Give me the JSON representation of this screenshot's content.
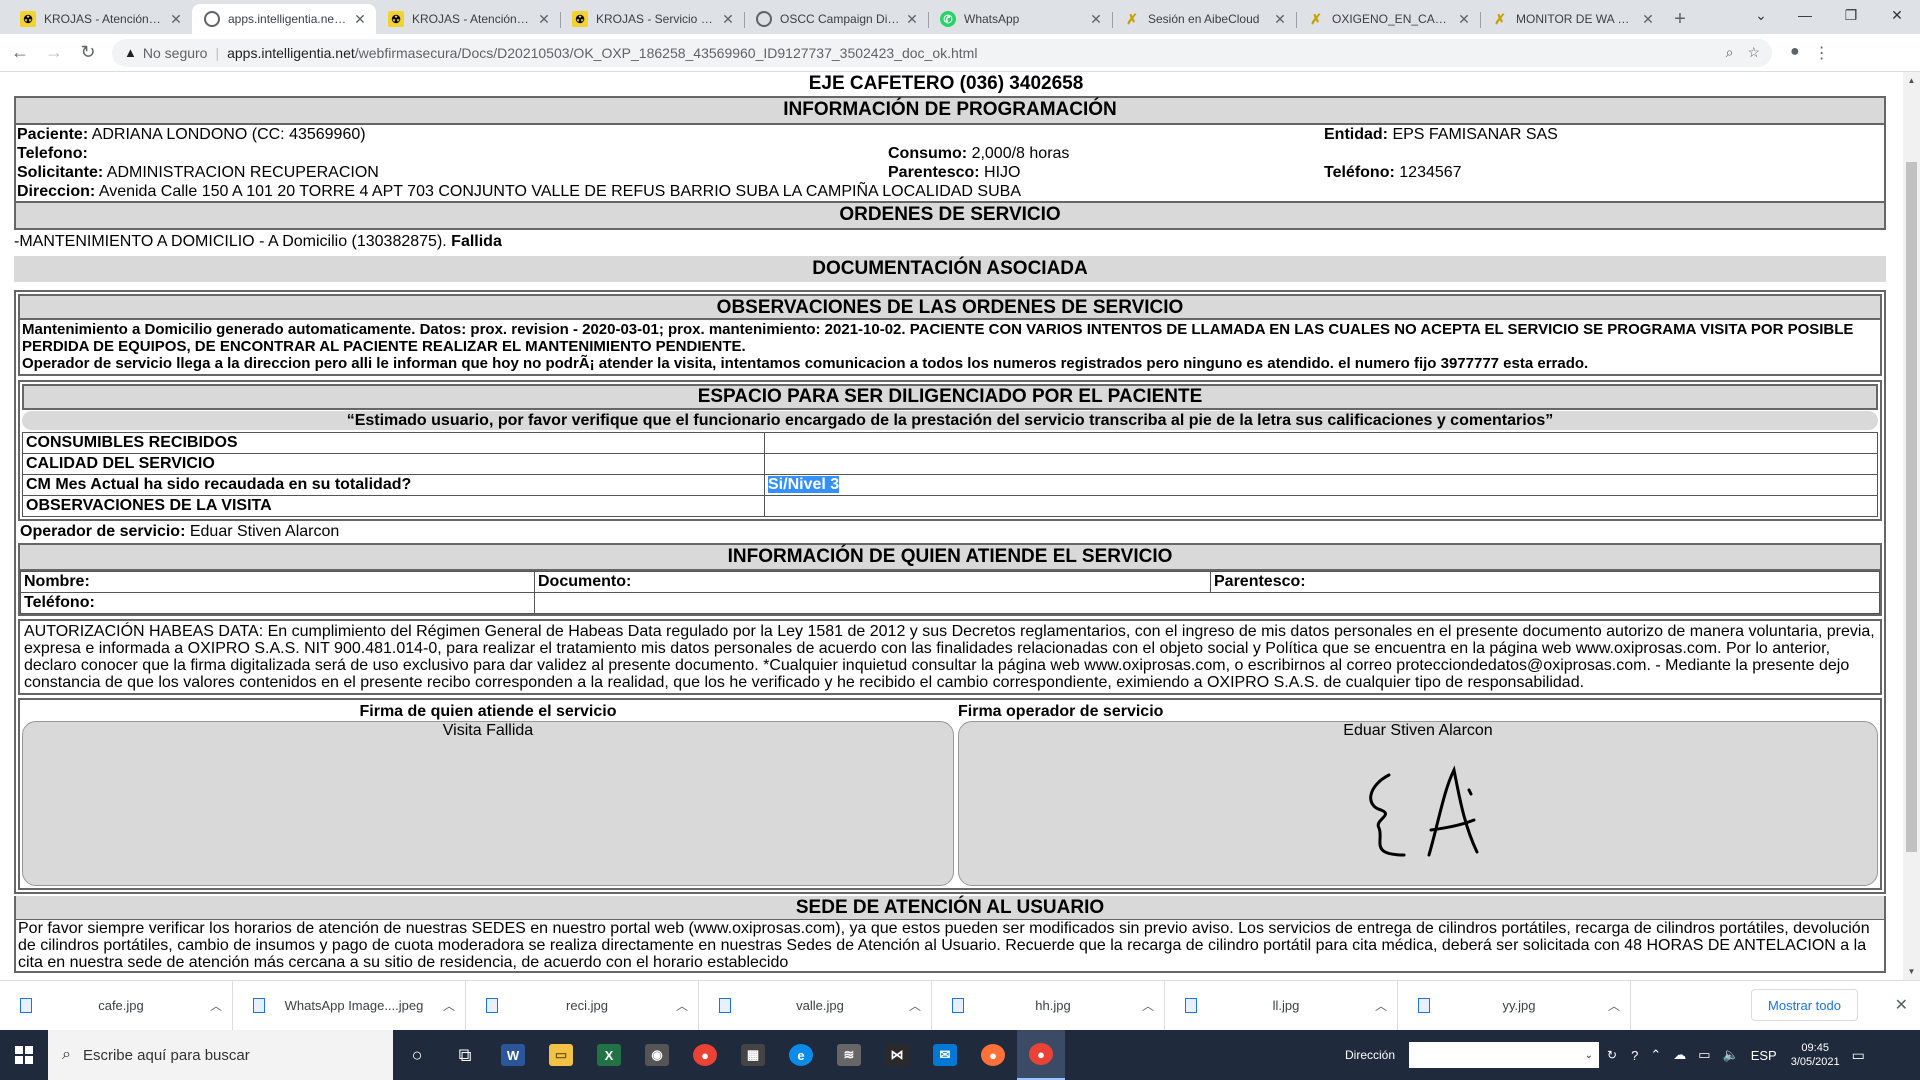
{
  "browser": {
    "tabs": [
      {
        "title": "KROJAS - Atención al Usuario",
        "icon": "krojas"
      },
      {
        "title": "apps.intelligentia.net/webfirmasecura",
        "icon": "globe",
        "active": true
      },
      {
        "title": "KROJAS - Atención al Usuario",
        "icon": "krojas"
      },
      {
        "title": "KROJAS - Servicio a Domicilio",
        "icon": "krojas"
      },
      {
        "title": "OSCC Campaign Director",
        "icon": "globe"
      },
      {
        "title": "WhatsApp",
        "icon": "whatsapp"
      },
      {
        "title": "Sesión en AibeCloud",
        "icon": "x"
      },
      {
        "title": "OXIGENO_EN_CASA (S",
        "icon": "x"
      },
      {
        "title": "MONITOR DE WA PEN",
        "icon": "x"
      }
    ],
    "new_tab_glyph": "+",
    "url_warning": "No seguro",
    "url_host": "apps.intelligentia.net",
    "url_path": "/webfirmasecura/Docs/D20210503/OK_OXP_186258_43569960_ID9127737_3502423_doc_ok.html"
  },
  "doc": {
    "top_line": "EJE CAFETERO (036) 3402658",
    "programacion": {
      "title": "INFORMACIÓN DE PROGRAMACIÓN",
      "paciente_label": "Paciente:",
      "paciente": "ADRIANA LONDONO (CC: 43569960)",
      "entidad_label": "Entidad:",
      "entidad": "EPS FAMISANAR SAS",
      "telefono_label": "Telefono:",
      "telefono": "",
      "consumo_label": "Consumo:",
      "consumo": "2,000/8 horas",
      "solicitante_label": "Solicitante:",
      "solicitante": "ADMINISTRACION RECUPERACION",
      "parentesco_label": "Parentesco:",
      "parentesco": "HIJO",
      "telefono2_label": "Teléfono:",
      "telefono2": "1234567",
      "direccion_label": "Direccion:",
      "direccion": "Avenida Calle 150 A 101 20 TORRE 4 APT 703 CONJUNTO VALLE DE REFUS BARRIO SUBA LA CAMPIÑA LOCALIDAD SUBA"
    },
    "ordenes": {
      "title": "ORDENES DE SERVICIO",
      "line": "-MANTENIMIENTO A DOMICILIO - A Domicilio (130382875).",
      "status": "Fallida"
    },
    "documentacion_title": "DOCUMENTACIÓN ASOCIADA",
    "observaciones": {
      "title": "OBSERVACIONES DE LAS ORDENES DE SERVICIO",
      "text1": "Mantenimiento a Domicilio generado automaticamente. Datos: prox. revision - 2020-03-01; prox. mantenimiento: 2021-10-02. PACIENTE CON VARIOS INTENTOS DE LLAMADA EN LAS CUALES NO ACEPTA EL SERVICIO SE PROGRAMA VISITA POR POSIBLE PERDIDA DE EQUIPOS, DE ENCONTRAR AL PACIENTE REALIZAR EL MANTENIMIENTO PENDIENTE.",
      "text2": "Operador de servicio llega a la direccion pero alli le informan que hoy no podrÃ¡ atender la visita, intentamos comunicacion a todos los numeros registrados pero ninguno es atendido. el numero fijo 3977777 esta errado."
    },
    "espacio": {
      "title": "ESPACIO PARA SER DILIGENCIADO POR EL PACIENTE",
      "notice": "“Estimado usuario, por favor verifique que el funcionario encargado de la prestación del servicio transcriba al pie de la letra sus calificaciones y comentarios”",
      "rows": [
        {
          "label": "CONSUMIBLES RECIBIDOS",
          "value": ""
        },
        {
          "label": "CALIDAD DEL SERVICIO",
          "value": ""
        },
        {
          "label": "CM Mes Actual ha sido recaudada en su totalidad?",
          "value": "Si/Nivel 3"
        },
        {
          "label": "OBSERVACIONES DE LA VISITA",
          "value": ""
        }
      ],
      "operador_label": "Operador de servicio:",
      "operador": "Eduar Stiven Alarcon"
    },
    "atiende": {
      "title": "INFORMACIÓN DE QUIEN ATIENDE EL SERVICIO",
      "nombre_label": "Nombre:",
      "documento_label": "Documento:",
      "parentesco_label": "Parentesco:",
      "telefono_label": "Teléfono:"
    },
    "habeas": "AUTORIZACIÓN HABEAS DATA: En cumplimiento del Régimen General de Habeas Data regulado por la Ley 1581 de 2012 y sus Decretos reglamentarios, con el ingreso de mis datos personales en el presente documento autorizo de manera voluntaria, previa, expresa e informada a OXIPRO S.A.S. NIT 900.481.014-0, para realizar el tratamiento mis datos personales de acuerdo con las finalidades relacionadas con el objeto social y Política que se encuentra en la página web www.oxiprosas.com. Por lo anterior, declaro conocer que la firma digitalizada será de uso exclusivo para dar validez al presente documento. *Cualquier inquietud consultar la página web www.oxiprosas.com, o escribirnos al correo protecciondedatos@oxiprosas.com. - Mediante la presente dejo constancia de que los valores contenidos en el presente recibo corresponden a la realidad, que los he verificado y he recibido el cambio correspondiente, eximiendo a OXIPRO S.A.S. de cualquier tipo de responsabilidad.",
    "firmas": {
      "left_title": "Firma de quien atiende el servicio",
      "left_value": "Visita Fallida",
      "right_title": "Firma operador de servicio",
      "right_value": "Eduar Stiven Alarcon"
    },
    "sede": {
      "title": "SEDE DE ATENCIÓN AL USUARIO",
      "text": "Por favor siempre verificar los horarios de atención de nuestras SEDES en nuestro portal web (www.oxiprosas.com), ya que estos pueden ser modificados sin previo aviso. Los servicios de entrega de cilindros portátiles, recarga de cilindros portátiles, devolución de cilindros portátiles, cambio de insumos y pago de cuota moderadora se realiza directamente en nuestras Sedes de Atención al Usuario. Recuerde que la recarga de cilindro portátil para cita médica, deberá ser solicitada con 48 HORAS DE ANTELACION a la cita en nuestra sede de atención más cercana a su sitio de residencia, de acuerdo con el horario establecido"
    }
  },
  "downloads": {
    "files": [
      "cafe.jpg",
      "WhatsApp Image....jpeg",
      "reci.jpg",
      "valle.jpg",
      "hh.jpg",
      "ll.jpg",
      "yy.jpg"
    ],
    "show_all": "Mostrar todo"
  },
  "taskbar": {
    "search_placeholder": "Escribe aquí para buscar",
    "address_label": "Dirección",
    "lang": "ESP",
    "time": "09:45",
    "date": "3/05/2021"
  },
  "colors": {
    "header_bg": "#d9d9d9",
    "selection": "#3390ff",
    "taskbar": "#1f2a3d",
    "krojas_yellow": "#f2d22e"
  }
}
